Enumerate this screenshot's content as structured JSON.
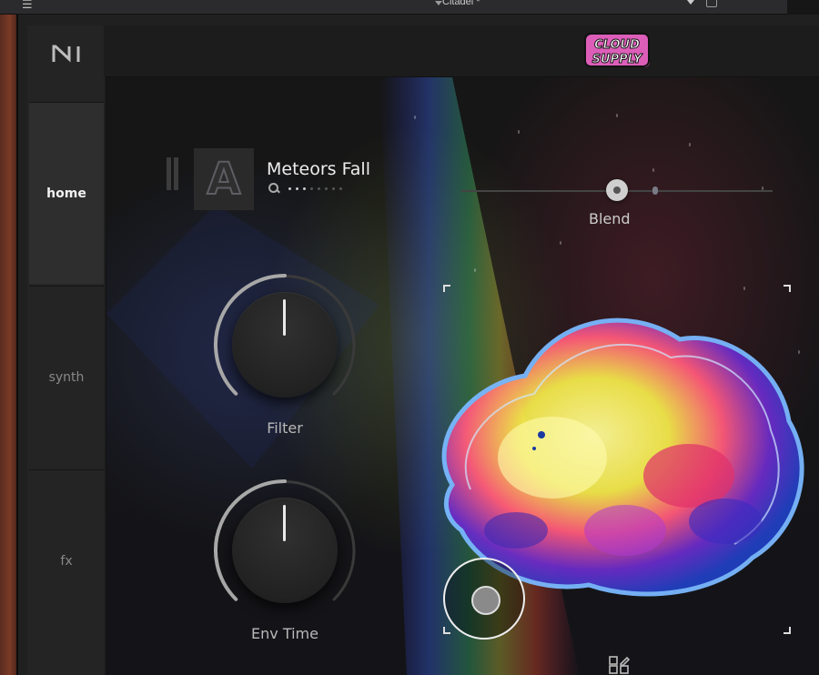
{
  "host": {
    "menu_icon": "hamburger-icon",
    "preset_label": "Citadel *"
  },
  "sidebar": {
    "tabs": [
      {
        "label": "home",
        "active": true
      },
      {
        "label": "synth",
        "active": false
      },
      {
        "label": "fx",
        "active": false
      }
    ]
  },
  "brand": {
    "logo_text_1": "CLOUD",
    "logo_text_2": "SUPPLY"
  },
  "preset": {
    "art_letter": "A",
    "name": "Meteors Fall",
    "dot_count": 8,
    "active_dots": 3
  },
  "blend": {
    "label": "Blend",
    "value": 0.5
  },
  "knobs": [
    {
      "label": "Filter",
      "value": 0.5
    },
    {
      "label": "Env Time",
      "value": 0.5
    }
  ],
  "colors": {
    "accent": "#e8e8e8",
    "background": "#202020"
  }
}
